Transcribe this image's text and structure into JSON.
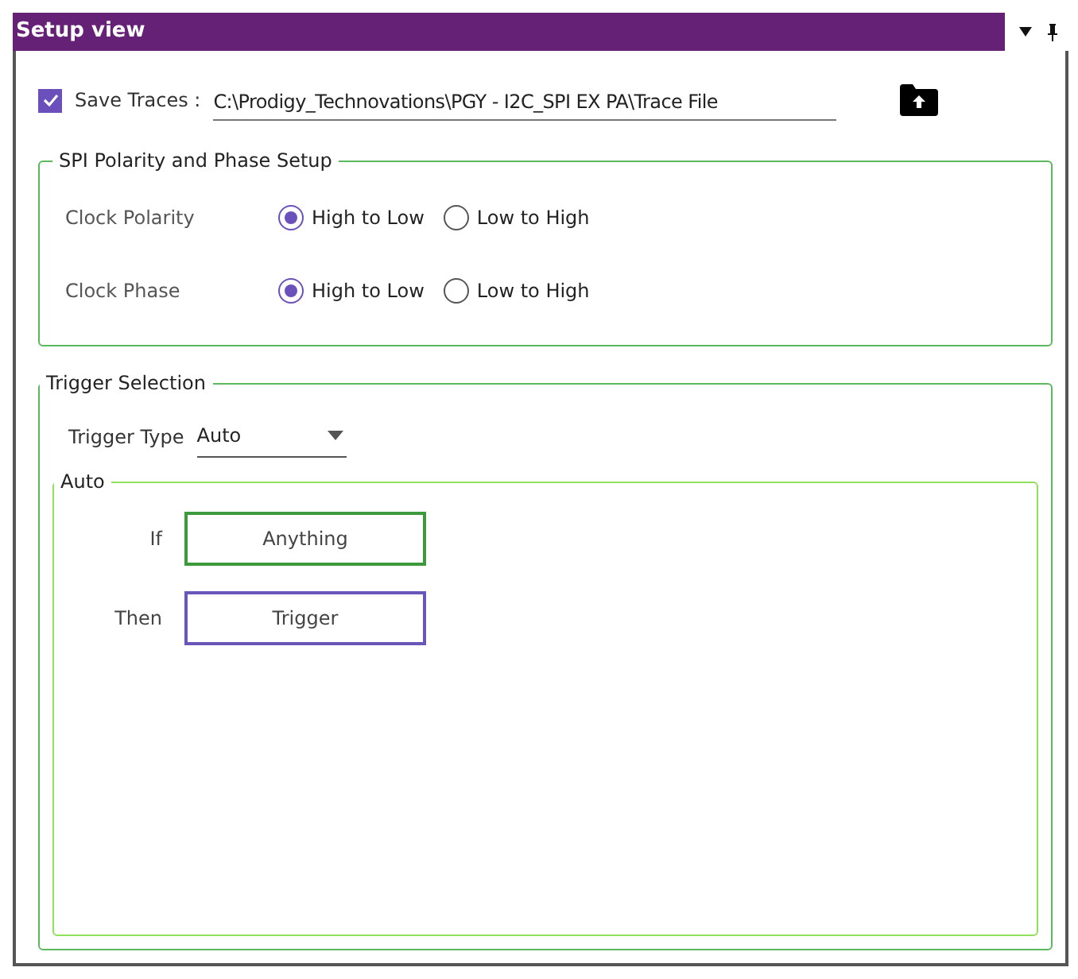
{
  "panel": {
    "title": "Setup view"
  },
  "save_traces": {
    "label": "Save Traces :",
    "checked": true,
    "path": "C:\\Prodigy_Technovations\\PGY - I2C_SPI EX PA\\Trace File"
  },
  "spi_setup": {
    "title": "SPI Polarity and Phase Setup",
    "settings": [
      {
        "label": "Clock Polarity",
        "options": [
          {
            "label": "High to Low",
            "selected": true
          },
          {
            "label": "Low to High",
            "selected": false
          }
        ]
      },
      {
        "label": "Clock Phase",
        "options": [
          {
            "label": "High to Low",
            "selected": true
          },
          {
            "label": "Low to High",
            "selected": false
          }
        ]
      }
    ]
  },
  "trigger_selection": {
    "title": "Trigger Selection",
    "type_label": "Trigger Type",
    "type_value": "Auto",
    "auto": {
      "title": "Auto",
      "conditions": [
        {
          "label": "If",
          "value": "Anything",
          "color": "#3c9a3c"
        },
        {
          "label": "Then",
          "value": "Trigger",
          "color": "#6a55b8"
        }
      ]
    }
  }
}
